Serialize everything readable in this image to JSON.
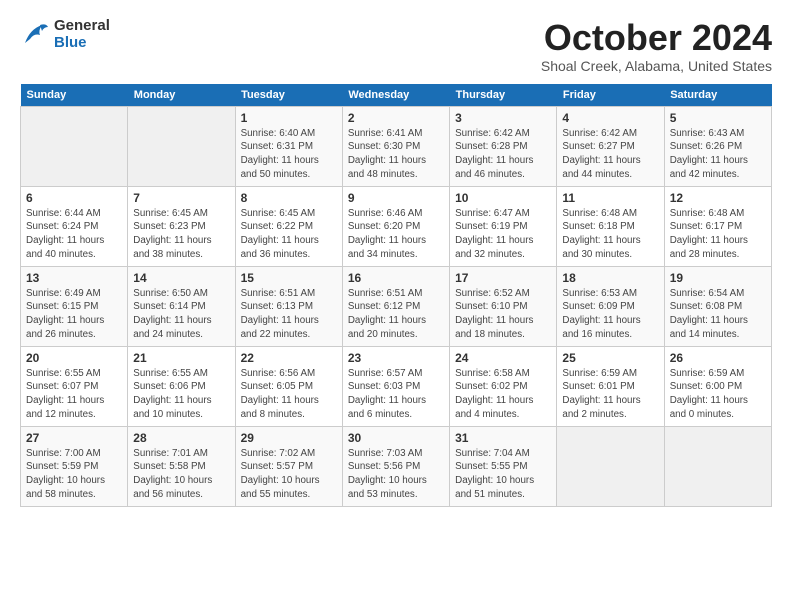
{
  "logo": {
    "general": "General",
    "blue": "Blue"
  },
  "title": "October 2024",
  "subtitle": "Shoal Creek, Alabama, United States",
  "days_of_week": [
    "Sunday",
    "Monday",
    "Tuesday",
    "Wednesday",
    "Thursday",
    "Friday",
    "Saturday"
  ],
  "weeks": [
    [
      {
        "day": "",
        "sunrise": "",
        "sunset": "",
        "daylight": "",
        "empty": true
      },
      {
        "day": "",
        "sunrise": "",
        "sunset": "",
        "daylight": "",
        "empty": true
      },
      {
        "day": "1",
        "sunrise": "Sunrise: 6:40 AM",
        "sunset": "Sunset: 6:31 PM",
        "daylight": "Daylight: 11 hours and 50 minutes."
      },
      {
        "day": "2",
        "sunrise": "Sunrise: 6:41 AM",
        "sunset": "Sunset: 6:30 PM",
        "daylight": "Daylight: 11 hours and 48 minutes."
      },
      {
        "day": "3",
        "sunrise": "Sunrise: 6:42 AM",
        "sunset": "Sunset: 6:28 PM",
        "daylight": "Daylight: 11 hours and 46 minutes."
      },
      {
        "day": "4",
        "sunrise": "Sunrise: 6:42 AM",
        "sunset": "Sunset: 6:27 PM",
        "daylight": "Daylight: 11 hours and 44 minutes."
      },
      {
        "day": "5",
        "sunrise": "Sunrise: 6:43 AM",
        "sunset": "Sunset: 6:26 PM",
        "daylight": "Daylight: 11 hours and 42 minutes."
      }
    ],
    [
      {
        "day": "6",
        "sunrise": "Sunrise: 6:44 AM",
        "sunset": "Sunset: 6:24 PM",
        "daylight": "Daylight: 11 hours and 40 minutes."
      },
      {
        "day": "7",
        "sunrise": "Sunrise: 6:45 AM",
        "sunset": "Sunset: 6:23 PM",
        "daylight": "Daylight: 11 hours and 38 minutes."
      },
      {
        "day": "8",
        "sunrise": "Sunrise: 6:45 AM",
        "sunset": "Sunset: 6:22 PM",
        "daylight": "Daylight: 11 hours and 36 minutes."
      },
      {
        "day": "9",
        "sunrise": "Sunrise: 6:46 AM",
        "sunset": "Sunset: 6:20 PM",
        "daylight": "Daylight: 11 hours and 34 minutes."
      },
      {
        "day": "10",
        "sunrise": "Sunrise: 6:47 AM",
        "sunset": "Sunset: 6:19 PM",
        "daylight": "Daylight: 11 hours and 32 minutes."
      },
      {
        "day": "11",
        "sunrise": "Sunrise: 6:48 AM",
        "sunset": "Sunset: 6:18 PM",
        "daylight": "Daylight: 11 hours and 30 minutes."
      },
      {
        "day": "12",
        "sunrise": "Sunrise: 6:48 AM",
        "sunset": "Sunset: 6:17 PM",
        "daylight": "Daylight: 11 hours and 28 minutes."
      }
    ],
    [
      {
        "day": "13",
        "sunrise": "Sunrise: 6:49 AM",
        "sunset": "Sunset: 6:15 PM",
        "daylight": "Daylight: 11 hours and 26 minutes."
      },
      {
        "day": "14",
        "sunrise": "Sunrise: 6:50 AM",
        "sunset": "Sunset: 6:14 PM",
        "daylight": "Daylight: 11 hours and 24 minutes."
      },
      {
        "day": "15",
        "sunrise": "Sunrise: 6:51 AM",
        "sunset": "Sunset: 6:13 PM",
        "daylight": "Daylight: 11 hours and 22 minutes."
      },
      {
        "day": "16",
        "sunrise": "Sunrise: 6:51 AM",
        "sunset": "Sunset: 6:12 PM",
        "daylight": "Daylight: 11 hours and 20 minutes."
      },
      {
        "day": "17",
        "sunrise": "Sunrise: 6:52 AM",
        "sunset": "Sunset: 6:10 PM",
        "daylight": "Daylight: 11 hours and 18 minutes."
      },
      {
        "day": "18",
        "sunrise": "Sunrise: 6:53 AM",
        "sunset": "Sunset: 6:09 PM",
        "daylight": "Daylight: 11 hours and 16 minutes."
      },
      {
        "day": "19",
        "sunrise": "Sunrise: 6:54 AM",
        "sunset": "Sunset: 6:08 PM",
        "daylight": "Daylight: 11 hours and 14 minutes."
      }
    ],
    [
      {
        "day": "20",
        "sunrise": "Sunrise: 6:55 AM",
        "sunset": "Sunset: 6:07 PM",
        "daylight": "Daylight: 11 hours and 12 minutes."
      },
      {
        "day": "21",
        "sunrise": "Sunrise: 6:55 AM",
        "sunset": "Sunset: 6:06 PM",
        "daylight": "Daylight: 11 hours and 10 minutes."
      },
      {
        "day": "22",
        "sunrise": "Sunrise: 6:56 AM",
        "sunset": "Sunset: 6:05 PM",
        "daylight": "Daylight: 11 hours and 8 minutes."
      },
      {
        "day": "23",
        "sunrise": "Sunrise: 6:57 AM",
        "sunset": "Sunset: 6:03 PM",
        "daylight": "Daylight: 11 hours and 6 minutes."
      },
      {
        "day": "24",
        "sunrise": "Sunrise: 6:58 AM",
        "sunset": "Sunset: 6:02 PM",
        "daylight": "Daylight: 11 hours and 4 minutes."
      },
      {
        "day": "25",
        "sunrise": "Sunrise: 6:59 AM",
        "sunset": "Sunset: 6:01 PM",
        "daylight": "Daylight: 11 hours and 2 minutes."
      },
      {
        "day": "26",
        "sunrise": "Sunrise: 6:59 AM",
        "sunset": "Sunset: 6:00 PM",
        "daylight": "Daylight: 11 hours and 0 minutes."
      }
    ],
    [
      {
        "day": "27",
        "sunrise": "Sunrise: 7:00 AM",
        "sunset": "Sunset: 5:59 PM",
        "daylight": "Daylight: 10 hours and 58 minutes."
      },
      {
        "day": "28",
        "sunrise": "Sunrise: 7:01 AM",
        "sunset": "Sunset: 5:58 PM",
        "daylight": "Daylight: 10 hours and 56 minutes."
      },
      {
        "day": "29",
        "sunrise": "Sunrise: 7:02 AM",
        "sunset": "Sunset: 5:57 PM",
        "daylight": "Daylight: 10 hours and 55 minutes."
      },
      {
        "day": "30",
        "sunrise": "Sunrise: 7:03 AM",
        "sunset": "Sunset: 5:56 PM",
        "daylight": "Daylight: 10 hours and 53 minutes."
      },
      {
        "day": "31",
        "sunrise": "Sunrise: 7:04 AM",
        "sunset": "Sunset: 5:55 PM",
        "daylight": "Daylight: 10 hours and 51 minutes."
      },
      {
        "day": "",
        "sunrise": "",
        "sunset": "",
        "daylight": "",
        "empty": true
      },
      {
        "day": "",
        "sunrise": "",
        "sunset": "",
        "daylight": "",
        "empty": true
      }
    ]
  ]
}
